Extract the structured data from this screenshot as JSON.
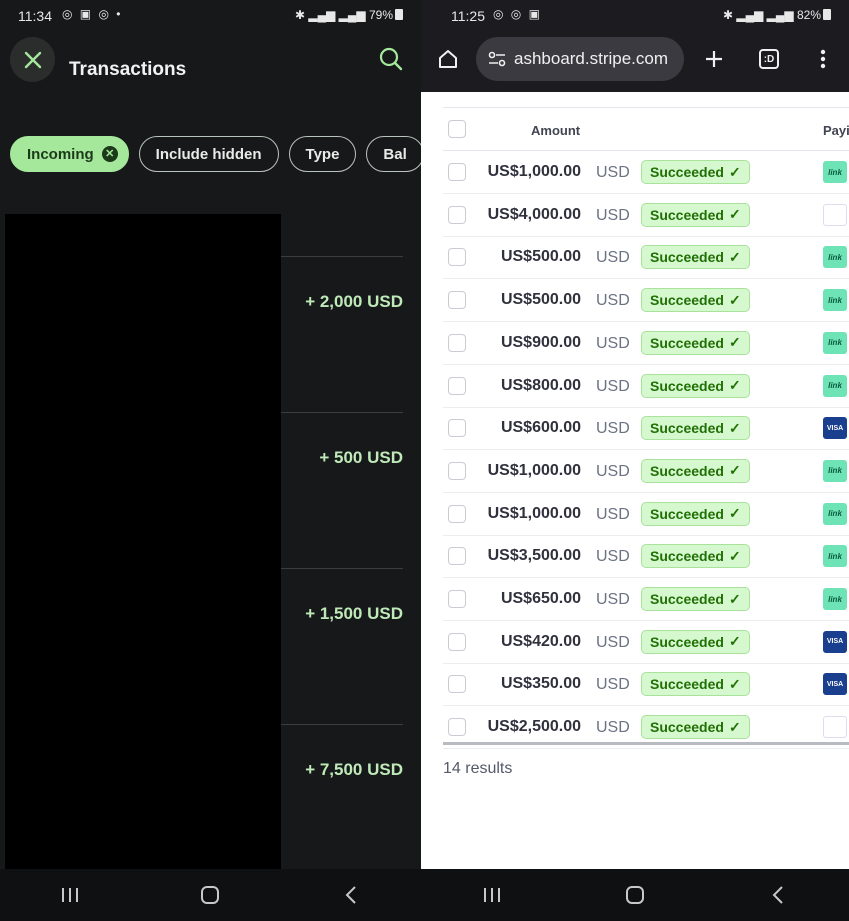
{
  "left": {
    "status": {
      "time": "11:34",
      "battery": "79%"
    },
    "title": "Transactions",
    "chips": [
      {
        "label": "Incoming",
        "active": true
      },
      {
        "label": "Include hidden",
        "active": false
      },
      {
        "label": "Type",
        "active": false
      },
      {
        "label": "Bal",
        "active": false
      }
    ],
    "amounts": [
      "+ 2,000 USD",
      "+ 500 USD",
      "+ 1,500 USD",
      "+ 7,500 USD"
    ]
  },
  "right": {
    "status": {
      "time": "11:25",
      "battery": "82%"
    },
    "url": "ashboard.stripe.com",
    "tab_count": ":D",
    "header": {
      "amount": "Amount",
      "payment": "Payi"
    },
    "rows": [
      {
        "amount": "US$1,000.00",
        "currency": "USD",
        "status": "Succeeded",
        "method": "link"
      },
      {
        "amount": "US$4,000.00",
        "currency": "USD",
        "status": "Succeeded",
        "method": "apple"
      },
      {
        "amount": "US$500.00",
        "currency": "USD",
        "status": "Succeeded",
        "method": "link"
      },
      {
        "amount": "US$500.00",
        "currency": "USD",
        "status": "Succeeded",
        "method": "link"
      },
      {
        "amount": "US$900.00",
        "currency": "USD",
        "status": "Succeeded",
        "method": "link"
      },
      {
        "amount": "US$800.00",
        "currency": "USD",
        "status": "Succeeded",
        "method": "link"
      },
      {
        "amount": "US$600.00",
        "currency": "USD",
        "status": "Succeeded",
        "method": "visa"
      },
      {
        "amount": "US$1,000.00",
        "currency": "USD",
        "status": "Succeeded",
        "method": "link"
      },
      {
        "amount": "US$1,000.00",
        "currency": "USD",
        "status": "Succeeded",
        "method": "link"
      },
      {
        "amount": "US$3,500.00",
        "currency": "USD",
        "status": "Succeeded",
        "method": "link"
      },
      {
        "amount": "US$650.00",
        "currency": "USD",
        "status": "Succeeded",
        "method": "link"
      },
      {
        "amount": "US$420.00",
        "currency": "USD",
        "status": "Succeeded",
        "method": "visa"
      },
      {
        "amount": "US$350.00",
        "currency": "USD",
        "status": "Succeeded",
        "method": "visa"
      },
      {
        "amount": "US$2,500.00",
        "currency": "USD",
        "status": "Succeeded",
        "method": "apple"
      }
    ],
    "results": "14 results"
  },
  "colors": {
    "accent_green": "#a5e89c",
    "success_bg": "#d6f8cf",
    "success_text": "#217005"
  }
}
